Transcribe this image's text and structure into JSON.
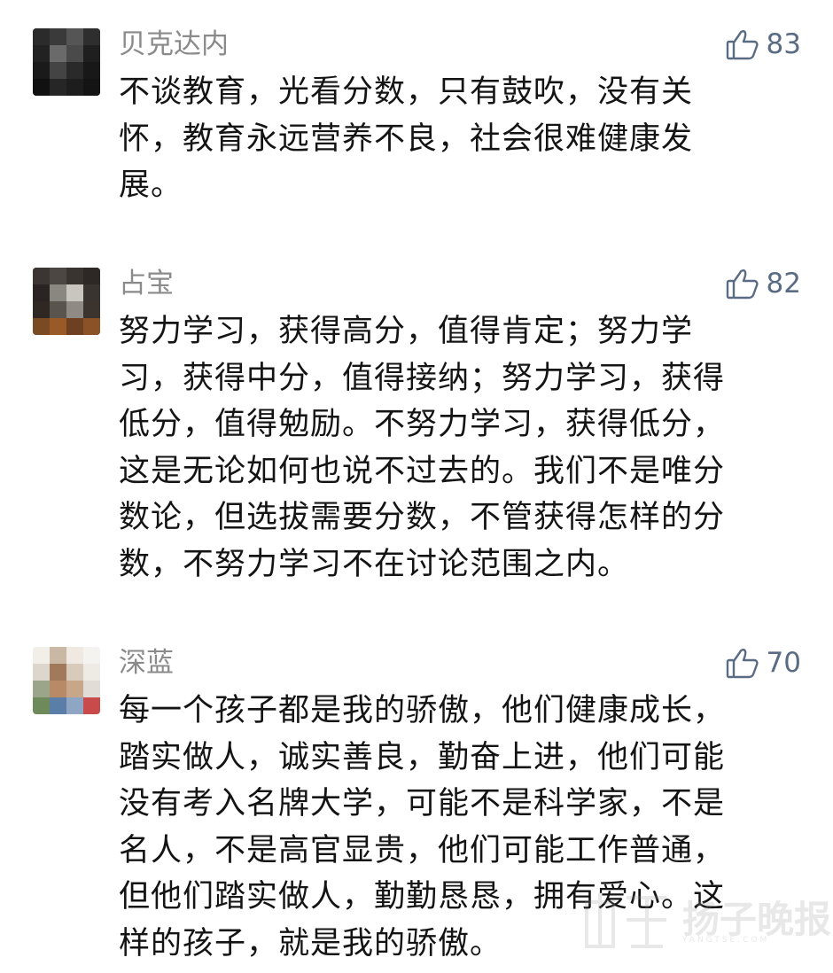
{
  "comments": [
    {
      "username": "贝克达内",
      "likes": "83",
      "like_icon": "thumbs-up-icon",
      "avatar": "blurred-avatar-dark",
      "lines": [
        "不谈教育，光看分数，只有鼓吹，没有关",
        "怀，教育永远营养不良，社会很难健康发",
        "展。"
      ]
    },
    {
      "username": "占宝",
      "likes": "82",
      "like_icon": "thumbs-up-icon",
      "avatar": "blurred-avatar-night-scene",
      "lines": [
        "努力学习，获得高分，值得肯定；努力学",
        "习，获得中分，值得接纳；努力学习，获得",
        "低分，值得勉励。不努力学习，获得低分，",
        "这是无论如何也说不过去的。我们不是唯分",
        "数论，但选拔需要分数，不管获得怎样的分",
        "数，不努力学习不在讨论范围之内。"
      ]
    },
    {
      "username": "深蓝",
      "likes": "70",
      "like_icon": "thumbs-up-icon",
      "avatar": "blurred-avatar-light-portrait",
      "lines": [
        "每一个孩子都是我的骄傲，他们健康成长，",
        "踏实做人，诚实善良，勤奋上进，他们可能",
        "没有考入名牌大学，可能不是科学家，不是",
        "名人，不是高官显贵，他们可能工作普通，",
        "但他们踏实做人，勤勤恳恳，拥有爱心。这",
        "样的孩子，就是我的骄傲。"
      ]
    }
  ],
  "watermark": {
    "text": "扬子晚报网",
    "sub": "YANGTSE.COM"
  },
  "colors": {
    "username": "#8a8a8a",
    "like": "#5a6c84",
    "text": "#141414",
    "background": "#ffffff"
  }
}
